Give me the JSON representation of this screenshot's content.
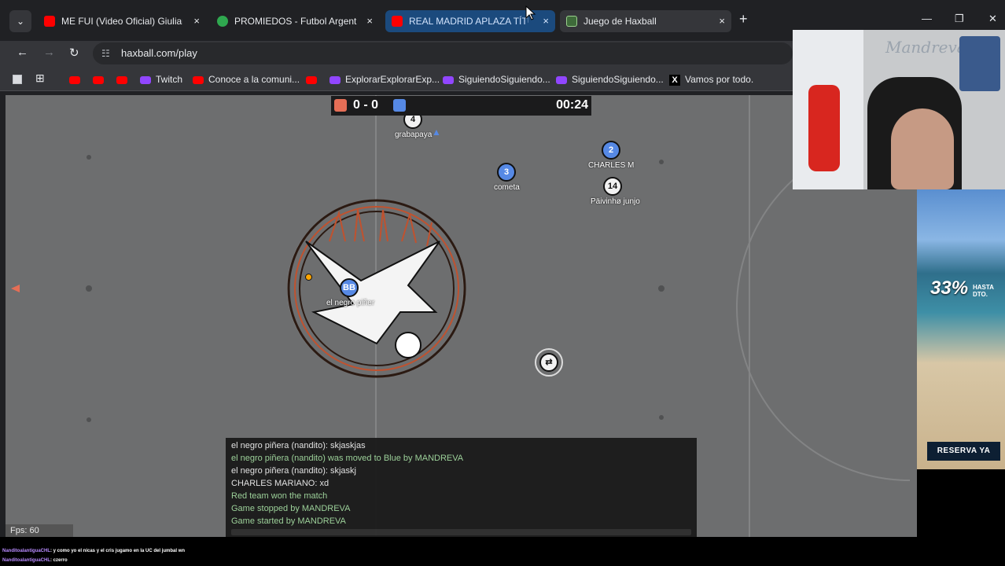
{
  "browser": {
    "tabs": [
      {
        "label": "ME FUI (Video Oficial) Giuliano",
        "favicon": "youtube-icon"
      },
      {
        "label": "PROMIEDOS - Futbol Argentino",
        "favicon": "promiedos-icon"
      },
      {
        "label": "REAL MADRID APLAZA TÍTULO",
        "favicon": "youtube-icon"
      },
      {
        "label": "Juego de Haxball",
        "favicon": "haxball-icon"
      }
    ],
    "tab_close": "×",
    "new_tab": "+",
    "url": "haxball.com/play",
    "window_controls": {
      "minimize": "—",
      "restore": "❐",
      "close": "✕"
    }
  },
  "bookmarks": [
    {
      "label": "",
      "icon": "youtube-icon"
    },
    {
      "label": "",
      "icon": "youtube-icon"
    },
    {
      "label": "",
      "icon": "youtube-icon"
    },
    {
      "label": "Twitch",
      "icon": "twitch-icon"
    },
    {
      "label": "Conoce a la comuni...",
      "icon": "youtube-icon"
    },
    {
      "label": "",
      "icon": "youtube-icon"
    },
    {
      "label": "ExplorarExplorarExp...",
      "icon": "twitch-icon"
    },
    {
      "label": "SiguiendoSiguiendo...",
      "icon": "twitch-icon"
    },
    {
      "label": "SiguiendoSiguiendo...",
      "icon": "twitch-icon"
    },
    {
      "label": "Vamos por todo.",
      "icon": "x-icon"
    }
  ],
  "game": {
    "score": "0 - 0",
    "timer": "00:24",
    "team_colors": {
      "red": "#e56e56",
      "blue": "#5689e5"
    },
    "players": [
      {
        "name": "grabapaya",
        "badge": "4",
        "team": "white"
      },
      {
        "name": "cometa",
        "badge": "3",
        "team": "blue"
      },
      {
        "name": "CHARLES M",
        "badge": "2",
        "team": "blue"
      },
      {
        "name": "Päivinhø junjo",
        "badge": "14",
        "team": "white"
      },
      {
        "name": "el negro piñer",
        "badge": "BB",
        "team": "blue"
      }
    ],
    "chat": [
      {
        "text": "el negro piñera (nandito): skjaskjas",
        "kind": "msg"
      },
      {
        "text": "el negro piñera (nandito) was moved to Blue by MANDREVA",
        "kind": "sys"
      },
      {
        "text": "el negro piñera (nandito): skjaskj",
        "kind": "msg"
      },
      {
        "text": "CHARLES MARIANO: xd",
        "kind": "msg"
      },
      {
        "text": "Red team won the match",
        "kind": "sys"
      },
      {
        "text": "Game stopped by MANDREVA",
        "kind": "sys"
      },
      {
        "text": "Game started by MANDREVA",
        "kind": "sys"
      }
    ],
    "fps": "Fps: 60"
  },
  "webcam": {
    "title": "Mandreva"
  },
  "ad": {
    "discount": "33%",
    "hasta_line1": "HASTA",
    "hasta_line2": "DTO.",
    "cta": "RESERVA YA"
  },
  "twitch_chat": [
    {
      "user": "NanditoalantiguaCHL",
      "text": ": y como yo el nicas y el cris jugamo en la UC del jumbal wn"
    },
    {
      "user": "NanditoalantiguaCHL",
      "text": ": czerro"
    }
  ]
}
